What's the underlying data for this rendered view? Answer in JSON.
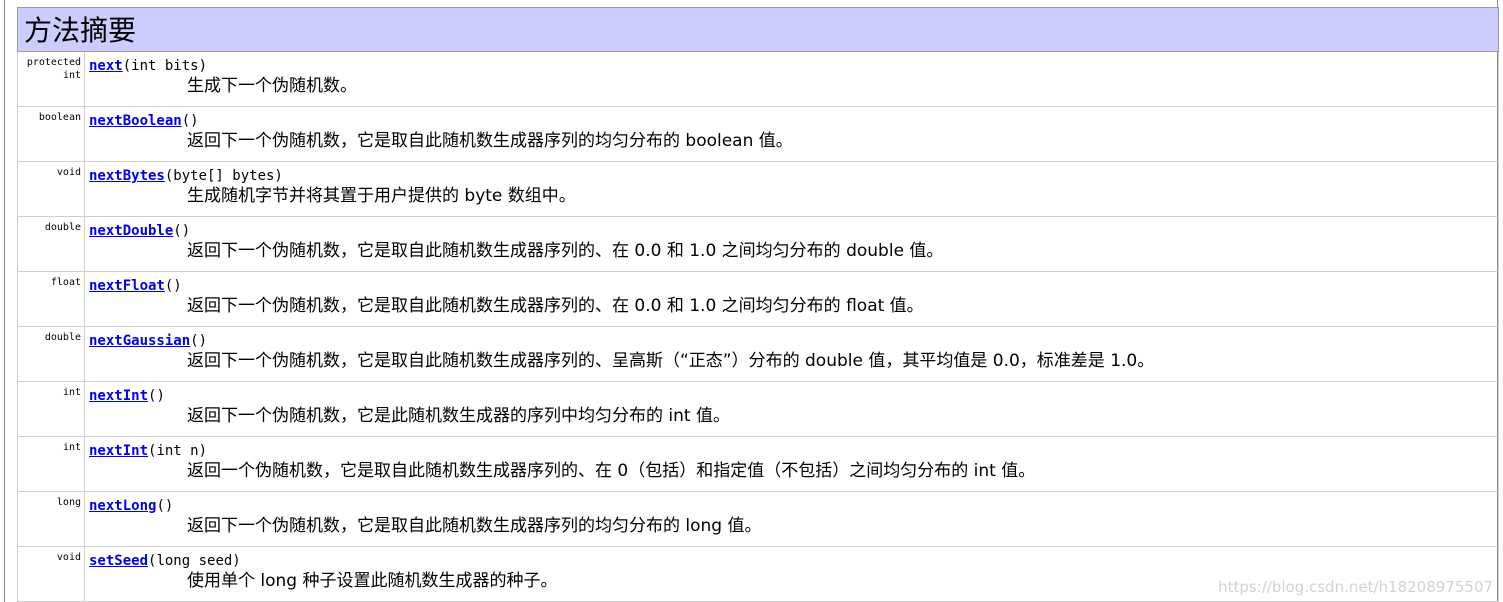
{
  "section_title": "方法摘要",
  "methods": [
    {
      "type": "protected int",
      "name": "next",
      "params": "(int bits)",
      "description": "生成下一个伪随机数。"
    },
    {
      "type": "boolean",
      "name": "nextBoolean",
      "params": "()",
      "description": "返回下一个伪随机数，它是取自此随机数生成器序列的均匀分布的 boolean 值。"
    },
    {
      "type": "void",
      "name": "nextBytes",
      "params": "(byte[] bytes)",
      "description": "生成随机字节并将其置于用户提供的 byte 数组中。"
    },
    {
      "type": "double",
      "name": "nextDouble",
      "params": "()",
      "description": "返回下一个伪随机数，它是取自此随机数生成器序列的、在 0.0 和 1.0 之间均匀分布的 double 值。"
    },
    {
      "type": "float",
      "name": "nextFloat",
      "params": "()",
      "description": "返回下一个伪随机数，它是取自此随机数生成器序列的、在 0.0 和 1.0 之间均匀分布的 float 值。"
    },
    {
      "type": "double",
      "name": "nextGaussian",
      "params": "()",
      "description": "返回下一个伪随机数，它是取自此随机数生成器序列的、呈高斯（“正态”）分布的 double 值，其平均值是 0.0，标准差是 1.0。"
    },
    {
      "type": "int",
      "name": "nextInt",
      "params": "()",
      "description": "返回下一个伪随机数，它是此随机数生成器的序列中均匀分布的 int 值。"
    },
    {
      "type": "int",
      "name": "nextInt",
      "params": "(int n)",
      "description": "返回一个伪随机数，它是取自此随机数生成器序列的、在 0（包括）和指定值（不包括）之间均匀分布的 int 值。"
    },
    {
      "type": "long",
      "name": "nextLong",
      "params": "()",
      "description": "返回下一个伪随机数，它是取自此随机数生成器序列的均匀分布的 long 值。"
    },
    {
      "type": "void",
      "name": "setSeed",
      "params": "(long seed)",
      "description": "使用单个 long 种子设置此随机数生成器的种子。"
    }
  ],
  "watermark": "https://blog.csdn.net/h18208975507",
  "colors": {
    "header_bg": "#ccccff",
    "link": "#0000ee",
    "border": "#cfcfcf"
  }
}
